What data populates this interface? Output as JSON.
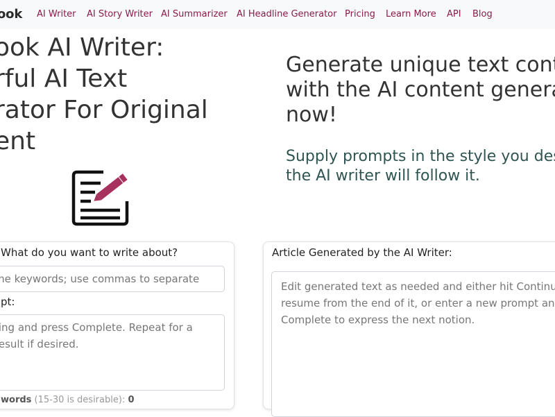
{
  "nav": {
    "brand": "ook",
    "links": [
      "AI Writer",
      "AI Story Writer",
      "AI Summarizer",
      "AI Headline Generator",
      "Pricing",
      "Learn More",
      "API",
      "Blog"
    ]
  },
  "hero": {
    "title_lines": [
      "ook AI Writer:",
      "rful AI Text",
      "rator For Original",
      "ent"
    ],
    "sub_lines": [
      "Generate unique text conte",
      "with the AI content generat",
      "now!"
    ],
    "note_lines": [
      "Supply prompts in the style you des",
      "the AI writer will follow it."
    ],
    "icon": "pencil-document-icon"
  },
  "left_card": {
    "question": "What do you want to write about?",
    "keywords_placeholder": "me keywords; use commas to separate",
    "prompt_label": "pt:",
    "prompt_lines": [
      "ting and press Complete. Repeat for a",
      "result if desired."
    ],
    "words_label": "words",
    "words_hint": "(15-30 is desirable):",
    "words_count": "0"
  },
  "right_card": {
    "title": "Article Generated by the AI Writer:",
    "placeholder_lines": [
      "Edit generated text as needed and either hit Continue t",
      "resume from the end of it, or enter a new prompt and h",
      "Complete to express the next notion."
    ]
  },
  "colors": {
    "nav_link": "#8b1a4a",
    "pencil": "#a8325e",
    "note": "#2f5552"
  }
}
